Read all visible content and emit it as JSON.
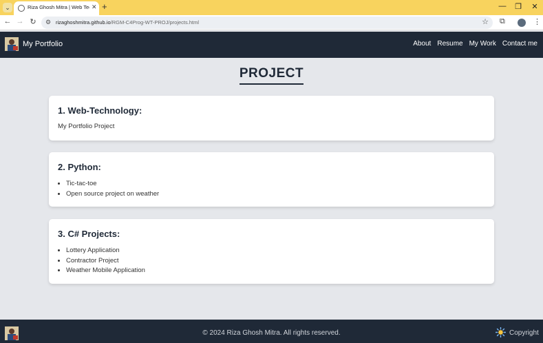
{
  "browser": {
    "tab_title": "Riza Ghosh Mitra | Web Tech | C",
    "url_host": "rizaghoshmitra.github.io",
    "url_path": "/RGM-C4Prog-WT-PROJ/projects.html"
  },
  "nav": {
    "brand": "My Portfolio",
    "links": [
      "About",
      "Resume",
      "My Work",
      "Contact me"
    ]
  },
  "page": {
    "title": "PROJECT",
    "sections": [
      {
        "heading": "1. Web-Technology:",
        "text": "My Portfolio Project"
      },
      {
        "heading": "2. Python:",
        "items": [
          "Tic-tac-toe",
          "Open source project on weather"
        ]
      },
      {
        "heading": "3. C# Projects:",
        "items": [
          "Lottery Application",
          "Contractor Project",
          "Weather Mobile Application"
        ]
      }
    ]
  },
  "footer": {
    "text": "© 2024 Riza Ghosh Mitra. All rights reserved.",
    "copyright_link": "Copyright"
  },
  "colors": {
    "nav_bg": "#1f2937",
    "page_bg": "#e5e7eb",
    "tabbar_bg": "#f8d35e"
  }
}
